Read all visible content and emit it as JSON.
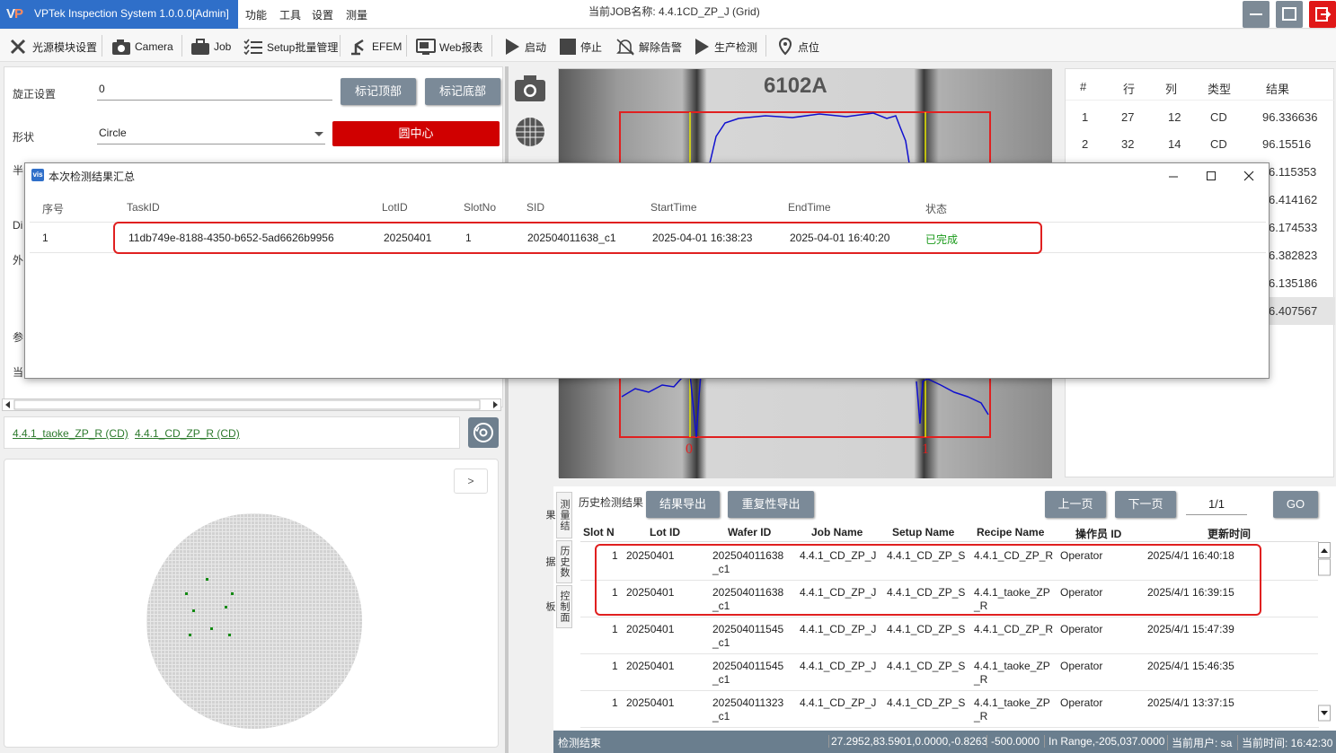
{
  "app": {
    "brand_title": "VPTek Inspection System 1.0.0.0[Admin]",
    "menus": [
      "功能",
      "工具",
      "设置",
      "测量"
    ],
    "job_name": "当前JOB名称:  4.4.1CD_ZP_J (Grid)"
  },
  "toolbar": {
    "items": [
      "光源模块设置",
      "Camera",
      "Job",
      "Setup批量管理",
      "EFEM",
      "Web报表",
      "启动",
      "停止",
      "解除告警",
      "生产检测",
      "点位"
    ]
  },
  "left": {
    "rotate_label": "旋正设置",
    "rotate_value": "0",
    "mark_top": "标记顶部",
    "mark_bottom": "标记底部",
    "shape_label": "形状",
    "shape_value": "Circle",
    "circle_center": "圆中心",
    "partial_labels": [
      "半",
      "Di",
      "外",
      "参",
      "当"
    ],
    "links": [
      "4.4.1_taoke_ZP_R (CD)",
      "4.4.1_CD_ZP_R (CD)"
    ],
    "expand": ">"
  },
  "image": {
    "label_text": "6102A",
    "marker_0": "0",
    "marker_1": "1"
  },
  "results": {
    "headers": [
      "#",
      "行",
      "列",
      "类型",
      "结果"
    ],
    "rows": [
      {
        "n": "1",
        "row": "27",
        "col": "12",
        "type": "CD",
        "value": "96.336636"
      },
      {
        "n": "2",
        "row": "32",
        "col": "14",
        "type": "CD",
        "value": "96.15516"
      }
    ],
    "partial_values": [
      "6.115353",
      "6.414162",
      "6.174533",
      "6.382823",
      "6.135186",
      "6.407567"
    ]
  },
  "dialog": {
    "title": "本次检测结果汇总",
    "headers": [
      "序号",
      "TaskID",
      "LotID",
      "SlotNo",
      "SID",
      "StartTime",
      "EndTime",
      "状态"
    ],
    "row": {
      "index": "1",
      "task_id": "11db749e-8188-4350-b652-5ad6626b9956",
      "lot_id": "20250401",
      "slot_no": "1",
      "sid": "202504011638_c1",
      "start": "2025-04-01 16:38:23",
      "end": "2025-04-01 16:40:20",
      "status": "已完成"
    },
    "status_color": "#1a9a1a"
  },
  "history": {
    "vtabs": [
      "测量结果",
      "历史数据",
      "控制面板"
    ],
    "title": "历史检测结果",
    "export_btn": "结果导出",
    "repeat_export_btn": "重复性导出",
    "prev_btn": "上一页",
    "next_btn": "下一页",
    "page": "1/1",
    "go_btn": "GO",
    "headers": [
      "Slot N",
      "Lot ID",
      "Wafer ID",
      "Job Name",
      "Setup Name",
      "Recipe Name",
      "操作员 ID",
      "更新时间"
    ],
    "rows": [
      {
        "slot": "1",
        "lot": "20250401",
        "wafer": "202504011638\n_c1",
        "job": "4.4.1_CD_ZP_J",
        "setup": "4.4.1_CD_ZP_S",
        "recipe": "4.4.1_CD_ZP_R",
        "op": "Operator",
        "time": "2025/4/1 16:40:18"
      },
      {
        "slot": "1",
        "lot": "20250401",
        "wafer": "202504011638\n_c1",
        "job": "4.4.1_CD_ZP_J",
        "setup": "4.4.1_CD_ZP_S",
        "recipe": "4.4.1_taoke_ZP\n_R",
        "op": "Operator",
        "time": "2025/4/1 16:39:15"
      },
      {
        "slot": "1",
        "lot": "20250401",
        "wafer": "202504011545\n_c1",
        "job": "4.4.1_CD_ZP_J",
        "setup": "4.4.1_CD_ZP_S",
        "recipe": "4.4.1_CD_ZP_R",
        "op": "Operator",
        "time": "2025/4/1 15:47:39"
      },
      {
        "slot": "1",
        "lot": "20250401",
        "wafer": "202504011545\n_c1",
        "job": "4.4.1_CD_ZP_J",
        "setup": "4.4.1_CD_ZP_S",
        "recipe": "4.4.1_taoke_ZP\n_R",
        "op": "Operator",
        "time": "2025/4/1 15:46:35"
      },
      {
        "slot": "1",
        "lot": "20250401",
        "wafer": "202504011323\n_c1",
        "job": "4.4.1_CD_ZP_J",
        "setup": "4.4.1_CD_ZP_S",
        "recipe": "4.4.1_taoke_ZP\n_R",
        "op": "Operator",
        "time": "2025/4/1 13:37:15"
      }
    ]
  },
  "status": {
    "left": "检测结束",
    "coords": "27.2952,83.5901,0.0000,-0.8263",
    "value": "-500.0000",
    "range": "In Range,-205,037.0000",
    "user": "当前用户:  sa",
    "time": "当前时间:  16:42:30"
  },
  "colors": {
    "brand": "#2f6fc9",
    "accent_red": "#d00000",
    "button_gray": "#7b8a98",
    "highlight_red": "#e02020"
  }
}
